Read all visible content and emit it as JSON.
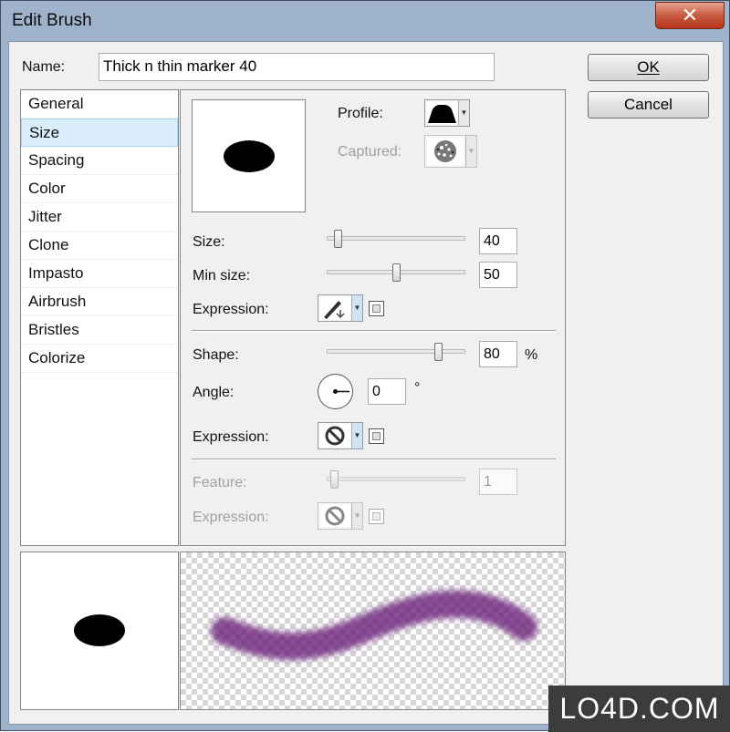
{
  "window": {
    "title": "Edit Brush",
    "close_symbol": "✕"
  },
  "name": {
    "label": "Name:",
    "value": "Thick n thin marker 40"
  },
  "buttons": {
    "ok": "OK",
    "cancel": "Cancel"
  },
  "categories": [
    {
      "label": "General"
    },
    {
      "label": "Size",
      "selected": true
    },
    {
      "label": "Spacing"
    },
    {
      "label": "Color"
    },
    {
      "label": "Jitter"
    },
    {
      "label": "Clone"
    },
    {
      "label": "Impasto"
    },
    {
      "label": "Airbrush"
    },
    {
      "label": "Bristles"
    },
    {
      "label": "Colorize"
    }
  ],
  "size_panel": {
    "profile_label": "Profile:",
    "captured_label": "Captured:",
    "size": {
      "label": "Size:",
      "value": "40",
      "slider_fraction": 0.08
    },
    "min_size": {
      "label": "Min size:",
      "value": "50",
      "slider_fraction": 0.5
    },
    "expression1": {
      "label": "Expression:",
      "icon": "pen-pressure-icon"
    },
    "shape": {
      "label": "Shape:",
      "value": "80",
      "unit": "%",
      "slider_fraction": 0.8
    },
    "angle": {
      "label": "Angle:",
      "value": "0",
      "unit": "°"
    },
    "expression2": {
      "label": "Expression:",
      "icon": "no-expression-icon"
    },
    "feature": {
      "label": "Feature:",
      "value": "1",
      "slider_fraction": 0.05,
      "disabled": true
    },
    "expression3": {
      "label": "Expression:",
      "icon": "no-expression-icon",
      "disabled": true
    }
  },
  "preview": {
    "stroke_color": "#6a1f7a"
  },
  "watermark": "LO4D.COM"
}
